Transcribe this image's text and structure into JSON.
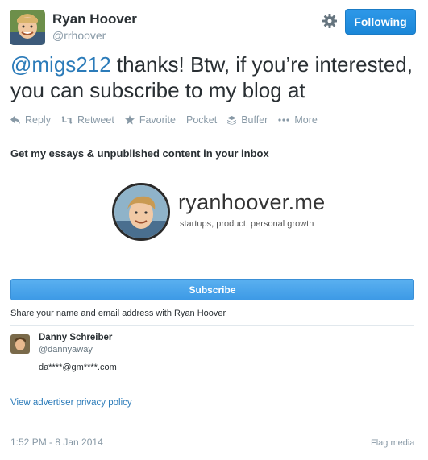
{
  "header": {
    "name": "Ryan Hoover",
    "handle": "@rrhoover",
    "follow_label": "Following"
  },
  "tweet": {
    "mention": "@migs212",
    "text": " thanks! Btw, if you’re interested, you can subscribe to my blog at"
  },
  "actions": [
    {
      "label": "Reply",
      "icon": "reply-icon"
    },
    {
      "label": "Retweet",
      "icon": "retweet-icon"
    },
    {
      "label": "Favorite",
      "icon": "star-icon"
    },
    {
      "label": "Pocket",
      "icon": ""
    },
    {
      "label": "Buffer",
      "icon": "buffer-icon"
    },
    {
      "label": "More",
      "icon": "more-icon"
    }
  ],
  "card": {
    "headline": "Get my essays & unpublished content in your inbox",
    "site_name": "ryanhoover.me",
    "tagline": "startups, product, personal growth",
    "subscribe_label": "Subscribe",
    "share_note": "Share your name and email address with Ryan Hoover",
    "user": {
      "name": "Danny Schreiber",
      "handle": "@dannyaway",
      "email": "da****@gm****.com"
    },
    "privacy_link": "View advertiser privacy policy"
  },
  "footer": {
    "timestamp": "1:52 PM - 8 Jan 2014",
    "flag_label": "Flag media"
  },
  "colors": {
    "link": "#2b7bb9",
    "muted": "#8899a6",
    "button_blue": "#2e98e8"
  }
}
